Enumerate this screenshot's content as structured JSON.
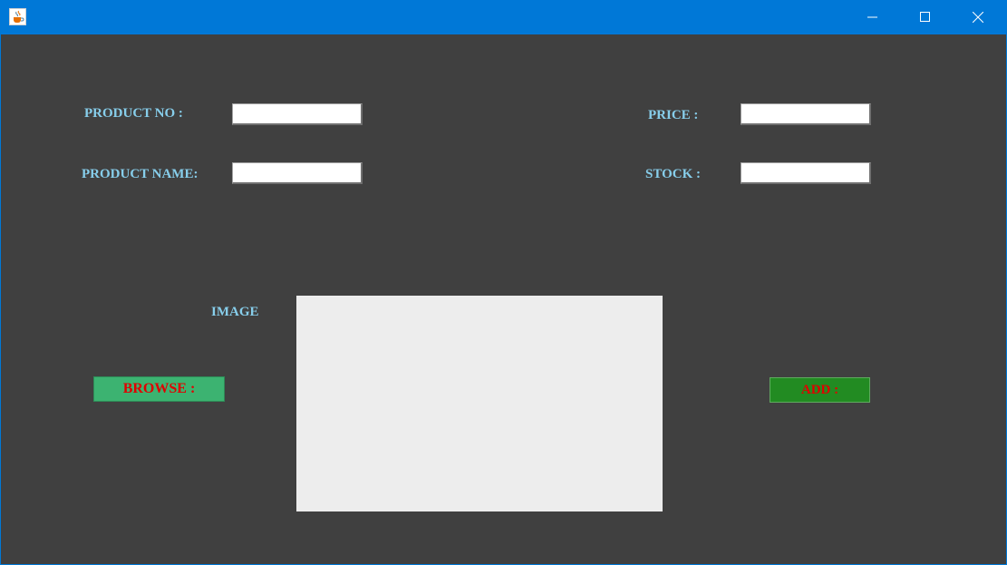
{
  "window": {
    "title": "",
    "controls": {
      "minimize": "minimize",
      "maximize": "maximize",
      "close": "close"
    }
  },
  "form": {
    "product_no_label": "PRODUCT NO :",
    "product_no_value": "",
    "product_name_label": "PRODUCT NAME:",
    "product_name_value": "",
    "price_label": "PRICE :",
    "price_value": "",
    "stock_label": "STOCK :",
    "stock_value": "",
    "image_label": "IMAGE",
    "browse_label": "BROWSE :",
    "add_label": "ADD :"
  },
  "colors": {
    "titlebar": "#0078d7",
    "background": "#404040",
    "label": "#87ceeb",
    "browse_button": "#3cb371",
    "add_button": "#228b22",
    "button_text": "#e00000",
    "image_panel": "#ededed"
  },
  "icons": {
    "app": "java-cup-icon",
    "minimize": "minimize-icon",
    "maximize": "maximize-icon",
    "close": "close-icon"
  }
}
